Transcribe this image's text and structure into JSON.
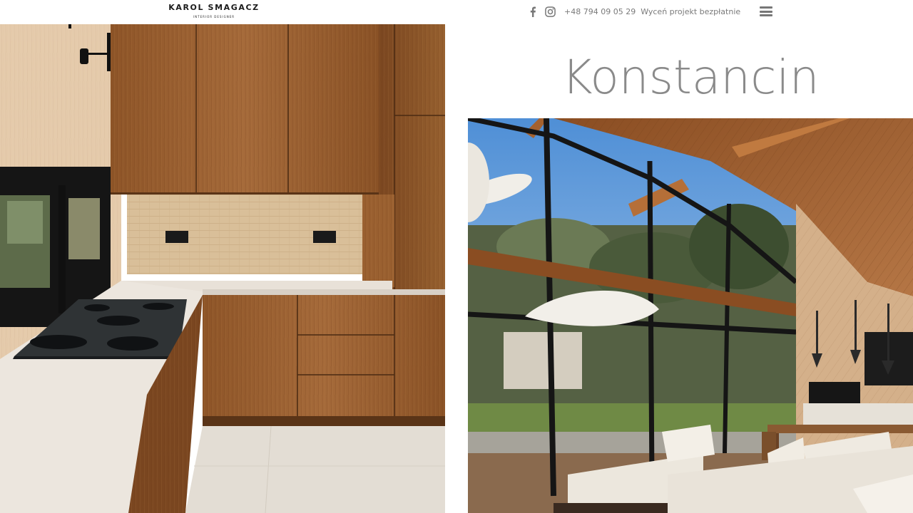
{
  "brand": {
    "name": "KAROL SMAGACZ",
    "tagline": "INTERIOR DESIGNER"
  },
  "topbar": {
    "facebook_icon": "facebook-icon",
    "instagram_icon": "instagram-icon",
    "phone": "+48 794 09 05 29",
    "quote_link": "Wyceń projekt bezpłatnie",
    "menu_icon": "hamburger-menu-icon"
  },
  "project": {
    "title": "Konstancin"
  },
  "photos": [
    {
      "subject": "kitchen"
    },
    {
      "subject": "living-room"
    }
  ],
  "colors": {
    "text_gray": "#7a7a7a",
    "title_gray": "#8a8a8a",
    "logo": "#1b1b1b",
    "wood": "#9a5f30"
  }
}
